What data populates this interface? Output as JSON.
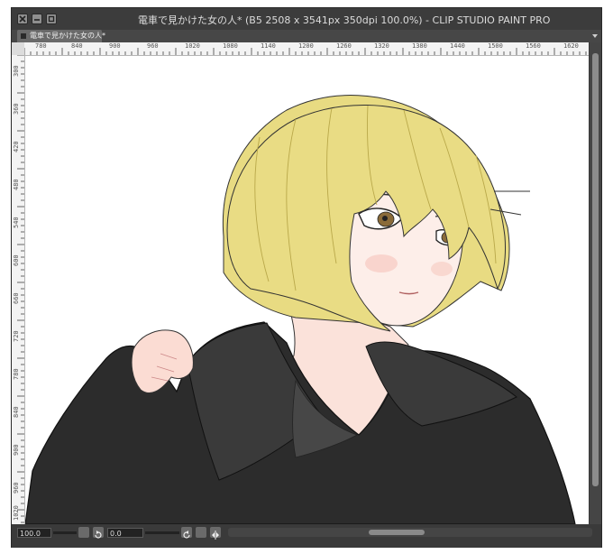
{
  "window": {
    "title": "電車で見かけた女の人* (B5 2508 x 3541px 350dpi 100.0%)  - CLIP STUDIO PAINT PRO",
    "tab_label": "電車で見かけた女の人*"
  },
  "rulers": {
    "horizontal": [
      "780",
      "840",
      "900",
      "960",
      "1020",
      "1080",
      "1140",
      "1200",
      "1260",
      "1320",
      "1380",
      "1440",
      "1500",
      "1560",
      "1620"
    ],
    "vertical": [
      "300",
      "360",
      "420",
      "480",
      "540",
      "600",
      "660",
      "720",
      "780",
      "840",
      "900",
      "960",
      "1020"
    ]
  },
  "status": {
    "zoom": "100.0",
    "angle": "0.0"
  },
  "colors": {
    "window_chrome": "#3b3b3b",
    "canvas": "#ffffff",
    "hair": "#e5dc86",
    "jacket": "#2b2b2b",
    "skin": "#fbe6e0"
  },
  "icons": [
    "close-icon",
    "minimize-icon",
    "maximize-icon",
    "rotate-left-icon",
    "rotate-right-icon",
    "flip-icon"
  ]
}
